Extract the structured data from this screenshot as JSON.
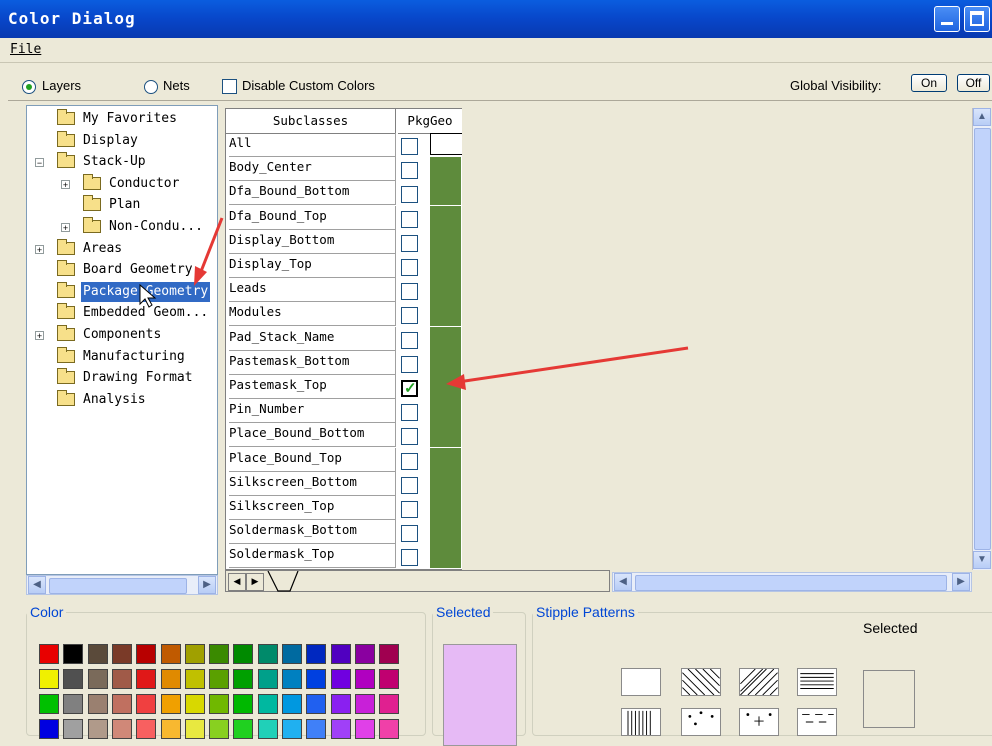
{
  "window": {
    "title": "Color Dialog"
  },
  "menu": {
    "file": "File"
  },
  "options": {
    "layers_label": "Layers",
    "nets_label": "Nets",
    "disable_custom_label": "Disable Custom Colors",
    "global_visibility_label": "Global Visibility:",
    "on_label": "On",
    "off_label": "Off",
    "selected_mode": "Layers"
  },
  "tree": {
    "items": [
      {
        "label": "My Favorites",
        "level": 0
      },
      {
        "label": "Display",
        "level": 0
      },
      {
        "label": "Stack-Up",
        "level": 0,
        "expanded": true
      },
      {
        "label": "Conductor",
        "level": 1,
        "expander": "+"
      },
      {
        "label": "Plan",
        "level": 1
      },
      {
        "label": "Non-Condu...",
        "level": 1,
        "expander": "+"
      },
      {
        "label": "Areas",
        "level": 0,
        "expander": "+"
      },
      {
        "label": "Board Geometry",
        "level": 0
      },
      {
        "label": "Package Geometry",
        "level": 0,
        "selected": true
      },
      {
        "label": "Embedded Geom...",
        "level": 0
      },
      {
        "label": "Components",
        "level": 0,
        "expander": "+"
      },
      {
        "label": "Manufacturing",
        "level": 0
      },
      {
        "label": "Drawing Format",
        "level": 0
      },
      {
        "label": "Analysis",
        "level": 0
      }
    ]
  },
  "grid": {
    "header_subclasses": "Subclasses",
    "header_column": "PkgGeo",
    "rows": [
      {
        "name": "All",
        "checked": false
      },
      {
        "name": "Body_Center",
        "checked": false
      },
      {
        "name": "Dfa_Bound_Bottom",
        "checked": false
      },
      {
        "name": "Dfa_Bound_Top",
        "checked": false
      },
      {
        "name": "Display_Bottom",
        "checked": false
      },
      {
        "name": "Display_Top",
        "checked": false
      },
      {
        "name": "Leads",
        "checked": false
      },
      {
        "name": "Modules",
        "checked": false
      },
      {
        "name": "Pad_Stack_Name",
        "checked": false
      },
      {
        "name": "Pastemask_Bottom",
        "checked": false
      },
      {
        "name": "Pastemask_Top",
        "checked": true
      },
      {
        "name": "Pin_Number",
        "checked": false
      },
      {
        "name": "Place_Bound_Bottom",
        "checked": false
      },
      {
        "name": "Place_Bound_Top",
        "checked": false
      },
      {
        "name": "Silkscreen_Bottom",
        "checked": false
      },
      {
        "name": "Silkscreen_Top",
        "checked": false
      },
      {
        "name": "Soldermask_Bottom",
        "checked": false
      },
      {
        "name": "Soldermask_Top",
        "checked": false
      }
    ],
    "swatch_color": "#5e8b3c"
  },
  "bottom": {
    "color_legend": "Color",
    "selected_legend": "Selected",
    "stipple_legend": "Stipple Patterns",
    "stipple_selected_label": "Selected",
    "selected_color": "#e6baf5",
    "palette": [
      [
        "#e80000",
        "#000000",
        "#5a4a3a",
        "#7a3a28",
        "#b80000",
        "#c05a00",
        "#a0a000",
        "#3a8a00",
        "#008a00",
        "#008a6a",
        "#006aa0",
        "#0028c0",
        "#5000c0",
        "#8a00a0",
        "#a00050"
      ],
      [
        "#f0f000",
        "#505050",
        "#7a6a5a",
        "#a05a48",
        "#e01818",
        "#e08a00",
        "#c0c000",
        "#5aa000",
        "#00a000",
        "#00a08a",
        "#0080c0",
        "#0040e0",
        "#7000e0",
        "#b000c0",
        "#c00070"
      ],
      [
        "#00c000",
        "#808080",
        "#9a8070",
        "#c07060",
        "#f04040",
        "#f0a000",
        "#d8d800",
        "#70b800",
        "#00b800",
        "#00b8a0",
        "#0098e0",
        "#2060f0",
        "#8a20f0",
        "#c820d8",
        "#e02090"
      ],
      [
        "#0000e0",
        "#a0a0a0",
        "#b09a8a",
        "#d08878",
        "#f86060",
        "#f8b830",
        "#e8e840",
        "#88d020",
        "#20d020",
        "#20d0b8",
        "#20b0f0",
        "#4080f8",
        "#a040f8",
        "#e040e8",
        "#f040a8"
      ]
    ]
  }
}
